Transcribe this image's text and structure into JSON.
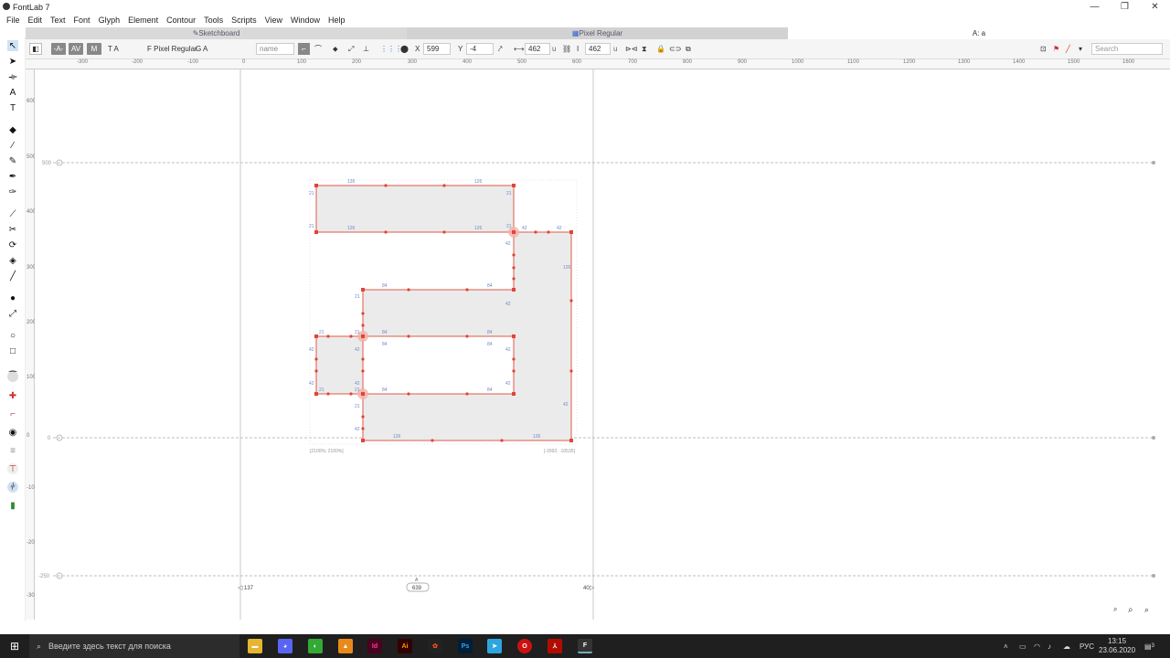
{
  "app": {
    "title": "FontLab 7"
  },
  "window_controls": {
    "minimize": "—",
    "maximize": "❐",
    "close": "✕"
  },
  "menu": [
    "File",
    "Edit",
    "Text",
    "Font",
    "Glyph",
    "Element",
    "Contour",
    "Tools",
    "Scripts",
    "View",
    "Window",
    "Help"
  ],
  "tabs": [
    {
      "label": "Sketchboard",
      "icon": "pencil-icon"
    },
    {
      "label": "Pixel Regular",
      "icon": "grid-icon"
    },
    {
      "label": "A: a"
    }
  ],
  "toolbar": {
    "font_label": "F Pixel Regular",
    "ga_label": "G A",
    "name_placeholder": "name",
    "x_label": "X",
    "x_value": "599",
    "y_label": "Y",
    "y_value": "-4",
    "width_value": "462",
    "width_unit": "u",
    "height_value": "462",
    "height_unit": "u",
    "search_placeholder": "Search",
    "ta_label": "T A"
  },
  "ruler_top": [
    "-300",
    "-200",
    "-100",
    "0",
    "100",
    "200",
    "300",
    "400",
    "500",
    "600",
    "700",
    "800",
    "900",
    "1000",
    "1100",
    "1200",
    "1300",
    "1400",
    "1500",
    "1600"
  ],
  "ruler_left": [
    "600",
    "500",
    "400",
    "300",
    "200",
    "100",
    "0",
    "-100",
    "-200",
    "-300"
  ],
  "guides": {
    "ascender": "500",
    "baseline": "0",
    "descender": "-250"
  },
  "metrics": {
    "left_sb": "137",
    "advance": "639",
    "right_sb": "40",
    "glyph_name": "A"
  },
  "corner_labels": {
    "bottom_left": "[2100%; 2100%]",
    "bottom_right": "[-3992; -10535]"
  },
  "segment_labels": [
    "126",
    "126",
    "126",
    "126",
    "21",
    "21",
    "21",
    "21",
    "42",
    "42",
    "42",
    "42",
    "126",
    "42",
    "84",
    "84",
    "84",
    "84",
    "84",
    "84",
    "84",
    "84",
    "21",
    "21",
    "21",
    "21",
    "21",
    "42",
    "42",
    "42",
    "42",
    "126",
    "126",
    "42",
    "21",
    "42",
    "42"
  ],
  "taskbar": {
    "search_text": "Введите здесь текст для поиска",
    "lang": "РУС",
    "time": "13:15",
    "date": "23.06.2020",
    "notif_count": "3"
  }
}
